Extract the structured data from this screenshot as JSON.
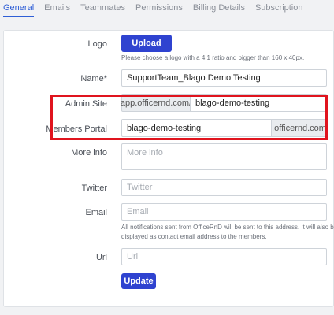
{
  "tabs": [
    {
      "label": "General",
      "active": true
    },
    {
      "label": "Emails",
      "active": false
    },
    {
      "label": "Teammates",
      "active": false
    },
    {
      "label": "Permissions",
      "active": false
    },
    {
      "label": "Billing Details",
      "active": false
    },
    {
      "label": "Subscription",
      "active": false
    }
  ],
  "form": {
    "logo": {
      "label": "Logo",
      "button": "Upload",
      "help": "Please choose a logo with a 4:1 ratio and bigger than 160 x 40px."
    },
    "name": {
      "label": "Name*",
      "value": "SupportTeam_Blago Demo Testing"
    },
    "admin_site": {
      "label": "Admin Site",
      "prefix": "app.officernd.com/",
      "value": "blago-demo-testing"
    },
    "members_portal": {
      "label": "Members Portal",
      "value": "blago-demo-testing",
      "suffix": ".officernd.com"
    },
    "more_info": {
      "label": "More info",
      "placeholder": "More info"
    },
    "twitter": {
      "label": "Twitter",
      "placeholder": "Twitter"
    },
    "email": {
      "label": "Email",
      "placeholder": "Email",
      "help_line1": "All notifications sent from OfficeRnD will be sent to this address. It will also be",
      "help_line2": "displayed as contact email address to the members."
    },
    "url": {
      "label": "Url",
      "placeholder": "Url"
    },
    "update_button": "Update"
  },
  "colors": {
    "primary": "#2f43d0",
    "highlight": "#e0141e",
    "active_tab": "#2f5fd6"
  }
}
